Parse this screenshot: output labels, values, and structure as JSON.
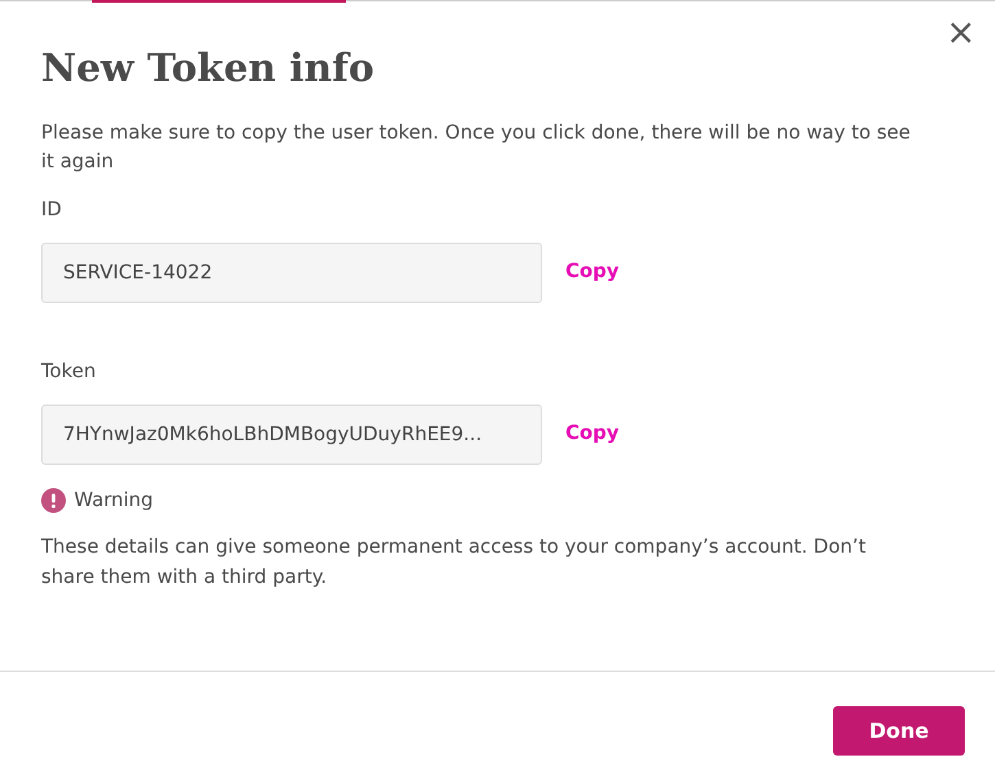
{
  "dialog": {
    "title": "New Token info",
    "close": "×",
    "intro": "Please make sure to copy the user token. Once you click done, there will be no way to see it again",
    "fields": [
      {
        "label": "ID",
        "value": "SERVICE-14022",
        "action": "Copy"
      },
      {
        "label": "Token",
        "value": "7HYnwJaz0Mk6hoLBhDMBogyUDuyRhEE9...",
        "action": "Copy"
      }
    ],
    "warning": {
      "title": "Warning",
      "text": "These details can give someone permanent access to your company’s account. Don’t share them with a third party."
    },
    "buttons": [
      "Done"
    ]
  }
}
